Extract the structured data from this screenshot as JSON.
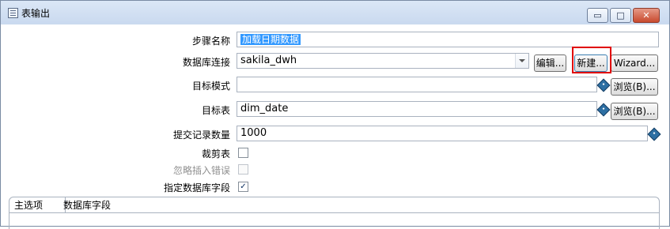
{
  "window": {
    "title": "表输出",
    "icon": "table-output-icon",
    "minimize": "▭",
    "maximize": "□",
    "close": "✕"
  },
  "form": {
    "step_name_label": "步骤名称",
    "step_name_value": "加载日期数据",
    "db_connection_label": "数据库连接",
    "db_connection_value": "sakila_dwh",
    "edit_button": "编辑...",
    "new_button": "新建...",
    "wizard_button": "Wizard...",
    "target_schema_label": "目标模式",
    "target_schema_value": "",
    "browse_schema_button": "浏览(B)...",
    "target_table_label": "目标表",
    "target_table_value": "dim_date",
    "browse_table_button": "浏览(B)...",
    "commit_size_label": "提交记录数量",
    "commit_size_value": "1000",
    "truncate_label": "裁剪表",
    "truncate_checked": false,
    "ignore_errors_label": "忽略插入错误",
    "ignore_errors_checked": false,
    "specify_fields_label": "指定数据库字段",
    "specify_fields_checked": true
  },
  "tabs": [
    {
      "label": "主选项",
      "active": true
    },
    {
      "label": "数据库字段",
      "active": false
    }
  ],
  "highlight_color": "#e00000"
}
